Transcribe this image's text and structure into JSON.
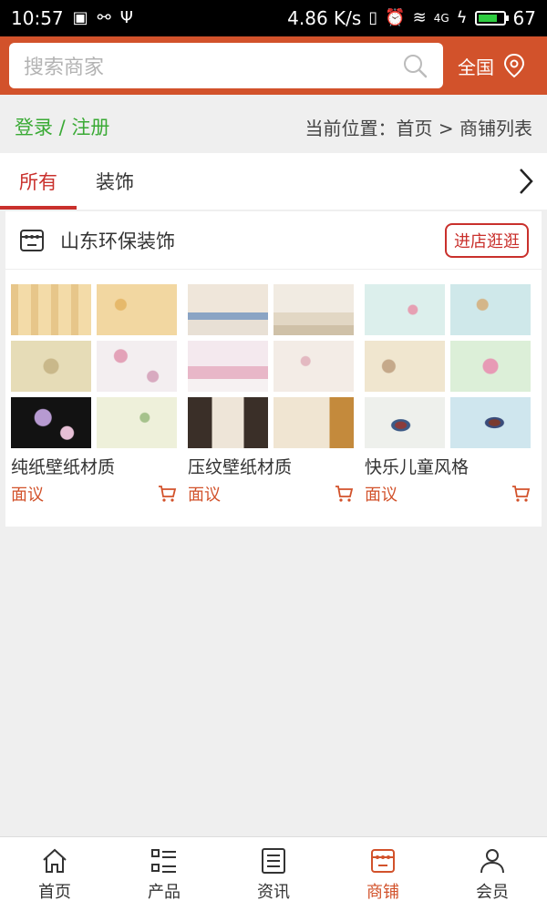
{
  "status": {
    "time": "10:57",
    "speed": "4.86 K/s",
    "battery": "67",
    "network": "4G"
  },
  "search": {
    "placeholder": "搜索商家",
    "region": "全国"
  },
  "breadcrumb": {
    "login": "登录 / 注册",
    "location": "当前位置：首页 > 商铺列表"
  },
  "tabs": [
    {
      "label": "所有",
      "active": true
    },
    {
      "label": "装饰",
      "active": false
    }
  ],
  "shop": {
    "name": "山东环保装饰",
    "visit_label": "进店逛逛",
    "products": [
      {
        "name": "纯纸壁纸材质",
        "price": "面议"
      },
      {
        "name": "压纹壁纸材质",
        "price": "面议"
      },
      {
        "name": "快乐儿童风格",
        "price": "面议"
      }
    ]
  },
  "nav": [
    {
      "label": "首页",
      "icon": "home-icon",
      "active": false
    },
    {
      "label": "产品",
      "icon": "list-icon",
      "active": false
    },
    {
      "label": "资讯",
      "icon": "news-icon",
      "active": false
    },
    {
      "label": "商铺",
      "icon": "shop-icon",
      "active": true
    },
    {
      "label": "会员",
      "icon": "user-icon",
      "active": false
    }
  ],
  "colors": {
    "brand": "#d2522b",
    "accent_red": "#c9302c",
    "login_green": "#3aaa35"
  }
}
